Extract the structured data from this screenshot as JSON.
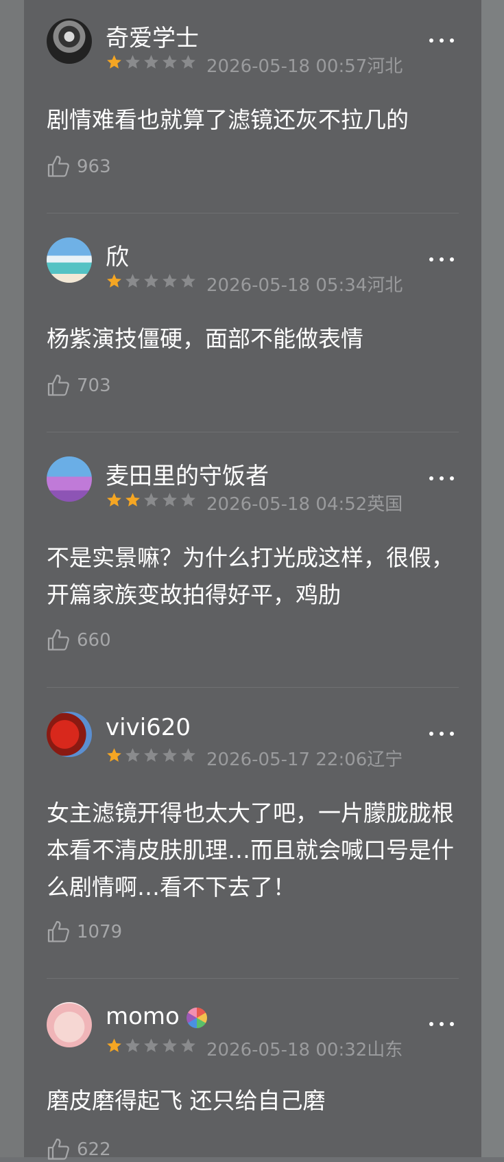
{
  "reviews": [
    {
      "name": "奇爱学士",
      "rating": 1,
      "date": "2026-05-18 00:57",
      "location": "河北",
      "text": "剧情难看也就算了滤镜还灰不拉几的",
      "likes": "963"
    },
    {
      "name": "欣",
      "rating": 1,
      "date": "2026-05-18 05:34",
      "location": "河北",
      "text": "杨紫演技僵硬，面部不能做表情",
      "likes": "703"
    },
    {
      "name": "麦田里的守饭者",
      "rating": 2,
      "date": "2026-05-18 04:52",
      "location": "英国",
      "text": "不是实景嘛？为什么打光成这样，很假，开篇家族变故拍得好平，鸡肋",
      "likes": "660"
    },
    {
      "name": "vivi620",
      "rating": 1,
      "date": "2026-05-17 22:06",
      "location": "辽宁",
      "text": "女主滤镜开得也太大了吧，一片朦胧胧根本看不清皮肤肌理…而且就会喊口号是什么剧情啊…看不下去了！",
      "likes": "1079"
    },
    {
      "name": "momo",
      "rating": 1,
      "date": "2026-05-18 00:32",
      "location": "山东",
      "text": "磨皮磨得起飞 还只给自己磨",
      "likes": "622"
    }
  ],
  "colors": {
    "star_on": "#f5a623",
    "star_off": "#8a8b8d"
  },
  "icons": {
    "more": "more-dots-icon",
    "like": "thumbs-up-icon",
    "star": "star-icon"
  }
}
